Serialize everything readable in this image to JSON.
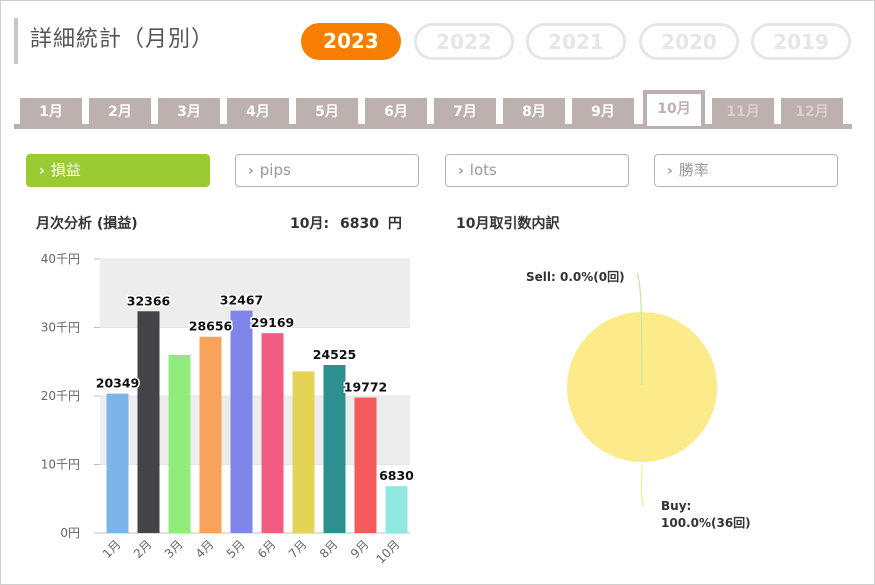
{
  "header": {
    "title": "詳細統計（月別）",
    "years": [
      {
        "label": "2023",
        "active": true
      },
      {
        "label": "2022",
        "active": false
      },
      {
        "label": "2021",
        "active": false
      },
      {
        "label": "2020",
        "active": false
      },
      {
        "label": "2019",
        "active": false
      }
    ]
  },
  "months": {
    "tabs": [
      "1月",
      "2月",
      "3月",
      "4月",
      "5月",
      "6月",
      "7月",
      "8月",
      "9月",
      "10月",
      "11月",
      "12月"
    ],
    "active_index": 9
  },
  "metrics": {
    "items": [
      "損益",
      "pips",
      "lots",
      "勝率"
    ],
    "active_index": 0,
    "chevron": "›"
  },
  "monthly": {
    "heading": "月次分析 (損益)",
    "summary_month": "10月:",
    "summary_value": "6830",
    "summary_unit": "円"
  },
  "breakdown": {
    "heading": "10月取引数内訳",
    "sell_label": "Sell: 0.0%(0回)",
    "buy_label_line1": "Buy:",
    "buy_label_line2": "100.0%(36回)"
  },
  "chart_data": [
    {
      "type": "bar",
      "categories": [
        "1月",
        "2月",
        "3月",
        "4月",
        "5月",
        "6月",
        "7月",
        "8月",
        "9月",
        "10月"
      ],
      "values": [
        20349,
        32366,
        26000,
        28656,
        32467,
        29169,
        23600,
        24525,
        19772,
        6830
      ],
      "data_labels": [
        "20349",
        "32366",
        "",
        "28656",
        "32467",
        "29169",
        "",
        "24525",
        "19772",
        "6830"
      ],
      "colors": [
        "#7cb5ec",
        "#434348",
        "#90ed7d",
        "#f7a35c",
        "#8085e9",
        "#f15c80",
        "#e4d354",
        "#2b908f",
        "#f45b5b",
        "#91e8e1"
      ],
      "yticks": [
        {
          "value": 0,
          "label": "0円"
        },
        {
          "value": 10000,
          "label": "10千円"
        },
        {
          "value": 20000,
          "label": "20千円"
        },
        {
          "value": 30000,
          "label": "30千円"
        },
        {
          "value": 40000,
          "label": "40千円"
        }
      ],
      "ylim": [
        0,
        40000
      ],
      "grid": true
    },
    {
      "type": "pie",
      "labels": [
        "Sell",
        "Buy"
      ],
      "values": [
        0,
        36
      ],
      "percentages": [
        0.0,
        100.0
      ],
      "colors": [
        "#9acb32",
        "#fdea8a"
      ]
    }
  ]
}
